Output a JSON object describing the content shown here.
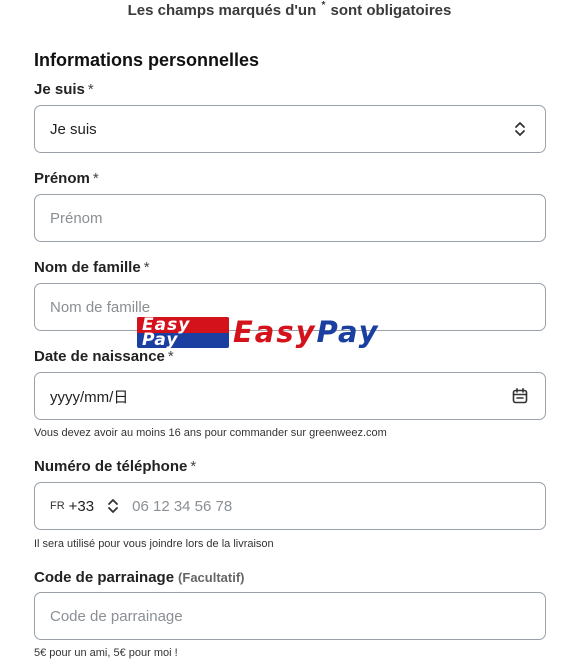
{
  "header": {
    "required_note_before": "Les champs marqués d'un",
    "required_note_star": "*",
    "required_note_after": "sont obligatoires"
  },
  "section": {
    "title": "Informations personnelles"
  },
  "fields": {
    "civility": {
      "label": "Je suis",
      "required": "*",
      "value": "Je suis",
      "icon": "chevron-updown-icon"
    },
    "first_name": {
      "label": "Prénom",
      "required": "*",
      "placeholder": "Prénom"
    },
    "last_name": {
      "label": "Nom de famille",
      "required": "*",
      "placeholder": "Nom de famille"
    },
    "birth_date": {
      "label": "Date de naissance",
      "required": "*",
      "placeholder": "yyyy/mm/日",
      "icon": "calendar-icon",
      "helper": "Vous devez avoir au moins 16 ans pour commander sur greenweez.com"
    },
    "phone": {
      "label": "Numéro de téléphone",
      "required": "*",
      "country": "FR",
      "code": "+33",
      "placeholder": "06 12 34 56 78",
      "helper": "Il sera utilisé pour vous joindre lors de la livraison"
    },
    "referral": {
      "label": "Code de parrainage",
      "optional": "(Facultatif)",
      "placeholder": "Code de parrainage",
      "helper": "5€ pour un ami, 5€ pour moi !"
    }
  },
  "watermark": {
    "box_line1": "Easy",
    "box_line2": "Pay",
    "word_part1": "Easy",
    "word_part2": "Pay",
    "red": "#d4121c",
    "blue": "#1a3fa0"
  }
}
